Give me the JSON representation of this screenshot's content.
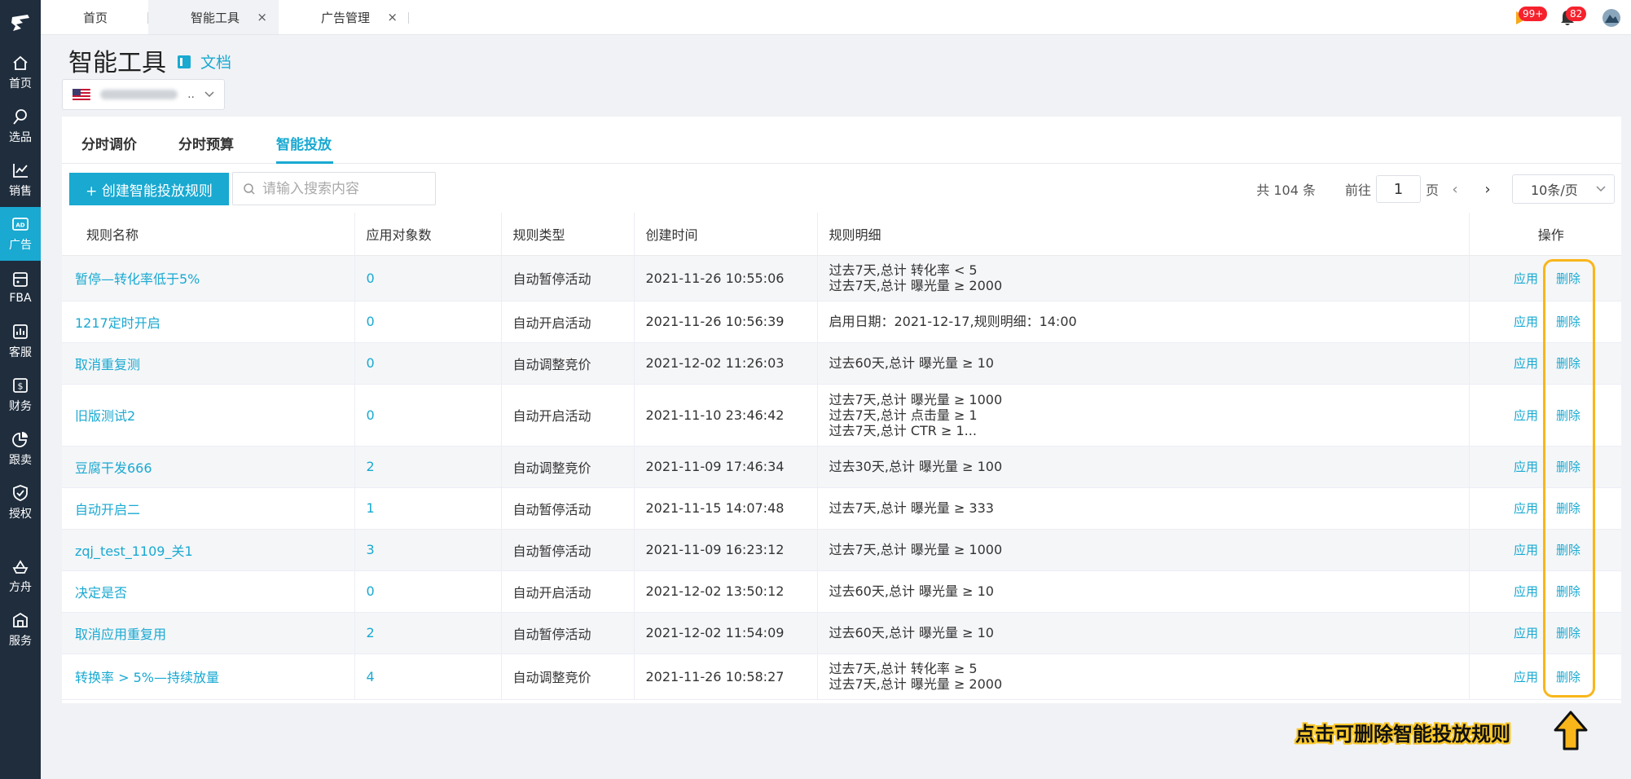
{
  "sidebar": {
    "items": [
      {
        "label": "首页",
        "icon": "home-icon"
      },
      {
        "label": "选品",
        "icon": "search-icon"
      },
      {
        "label": "销售",
        "icon": "chart-line-icon"
      },
      {
        "label": "广告",
        "icon": "ad-icon",
        "active": true
      },
      {
        "label": "FBA",
        "icon": "fba-box-icon"
      },
      {
        "label": "客服",
        "icon": "bar-chart-icon"
      },
      {
        "label": "财务",
        "icon": "dollar-icon"
      },
      {
        "label": "跟卖",
        "icon": "pie-chart-icon"
      },
      {
        "label": "授权",
        "icon": "shield-check-icon"
      },
      {
        "label": "方舟",
        "icon": "ark-icon"
      },
      {
        "label": "服务",
        "icon": "service-building-icon"
      }
    ]
  },
  "topbar": {
    "tabs": [
      {
        "label": "首页"
      },
      {
        "label": "智能工具",
        "active": true,
        "close": "×"
      },
      {
        "label": "广告管理",
        "close": "×"
      }
    ],
    "badge_flag": "99+",
    "badge_bell": "82"
  },
  "header": {
    "title": "智能工具",
    "doc_label": "文档",
    "shop_dots": ".."
  },
  "subtabs": [
    "分时调价",
    "分时预算",
    "智能投放"
  ],
  "toolbar": {
    "create_label": "+ 创建智能投放规则",
    "search_placeholder": "请输入搜索内容"
  },
  "pagination": {
    "total": "共 104 条",
    "goto_prefix": "前往",
    "page": "1",
    "goto_suffix": "页",
    "prev": "‹",
    "next": "›",
    "page_size": "10条/页"
  },
  "table": {
    "headers": [
      "规则名称",
      "应用对象数",
      "规则类型",
      "创建时间",
      "规则明细",
      "操作"
    ],
    "apply_label": "应用",
    "delete_label": "删除",
    "rows": [
      {
        "name": "暂停—转化率低于5%",
        "count": "0",
        "type": "自动暂停活动",
        "created": "2021-11-26 10:55:06",
        "details": [
          "过去7天,总计  转化率 < 5",
          "过去7天,总计  曝光量 ≥ 2000"
        ]
      },
      {
        "name": "1217定时开启",
        "count": "0",
        "type": "自动开启活动",
        "created": "2021-11-26 10:56:39",
        "details": [
          "启用日期：2021-12-17,规则明细：14:00"
        ]
      },
      {
        "name": "取消重复测",
        "count": "0",
        "type": "自动调整竞价",
        "created": "2021-12-02 11:26:03",
        "details": [
          "过去60天,总计  曝光量 ≥ 10"
        ]
      },
      {
        "name": "旧版测试2",
        "count": "0",
        "type": "自动开启活动",
        "created": "2021-11-10 23:46:42",
        "details": [
          "过去7天,总计  曝光量 ≥ 1000",
          "过去7天,总计  点击量 ≥ 1",
          "过去7天,总计  CTR ≥ 1..."
        ]
      },
      {
        "name": "豆腐干发666",
        "count": "2",
        "type": "自动调整竞价",
        "created": "2021-11-09 17:46:34",
        "details": [
          "过去30天,总计  曝光量 ≥ 100"
        ]
      },
      {
        "name": "自动开启二",
        "count": "1",
        "type": "自动暂停活动",
        "created": "2021-11-15 14:07:48",
        "details": [
          "过去7天,总计  曝光量 ≥ 333"
        ]
      },
      {
        "name": "zqj_test_1109_关1",
        "count": "3",
        "type": "自动暂停活动",
        "created": "2021-11-09 16:23:12",
        "details": [
          "过去7天,总计  曝光量 ≥ 1000"
        ]
      },
      {
        "name": "决定是否",
        "count": "0",
        "type": "自动开启活动",
        "created": "2021-12-02 13:50:12",
        "details": [
          "过去60天,总计  曝光量 ≥ 10"
        ]
      },
      {
        "name": "取消应用重复用",
        "count": "2",
        "type": "自动暂停活动",
        "created": "2021-12-02 11:54:09",
        "details": [
          "过去60天,总计  曝光量 ≥ 10"
        ]
      },
      {
        "name": "转换率 > 5%—持续放量",
        "count": "4",
        "type": "自动调整竞价",
        "created": "2021-11-26 10:58:27",
        "details": [
          "过去7天,总计  转化率 ≥ 5",
          "过去7天,总计  曝光量 ≥ 2000"
        ]
      }
    ]
  },
  "annotation": {
    "text": "点击可删除智能投放规则",
    "color": "#f9b61b"
  }
}
